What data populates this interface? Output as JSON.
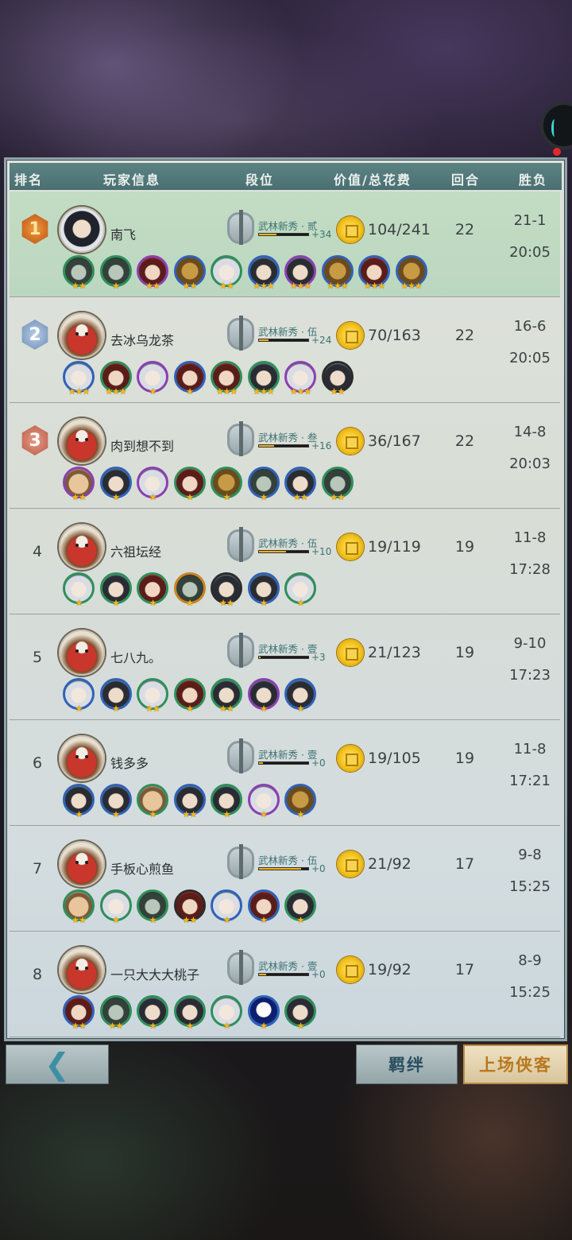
{
  "header": {
    "rank": "排名",
    "player": "玩家信息",
    "tier": "段位",
    "value": "价值/总花费",
    "rounds": "回合",
    "winloss": "胜负"
  },
  "players": [
    {
      "rank": "1",
      "name": "南飞",
      "tier": "武林新秀 · 贰",
      "tier_plus": "+34",
      "tier_progress": 0.35,
      "value": "104/241",
      "rounds": "22",
      "winloss": "21-1",
      "time": "20:05"
    },
    {
      "rank": "2",
      "name": "去冰乌龙茶",
      "tier": "武林新秀 · 伍",
      "tier_plus": "+24",
      "tier_progress": 0.2,
      "value": "70/163",
      "rounds": "22",
      "winloss": "16-6",
      "time": "20:05"
    },
    {
      "rank": "3",
      "name": "肉到想不到",
      "tier": "武林新秀 · 叁",
      "tier_plus": "+16",
      "tier_progress": 0.3,
      "value": "36/167",
      "rounds": "22",
      "winloss": "14-8",
      "time": "20:03"
    },
    {
      "rank": "4",
      "name": "六祖坛经",
      "tier": "武林新秀 · 伍",
      "tier_plus": "+10",
      "tier_progress": 0.55,
      "value": "19/119",
      "rounds": "19",
      "winloss": "11-8",
      "time": "17:28"
    },
    {
      "rank": "5",
      "name": "七八九。",
      "tier": "武林新秀 · 壹",
      "tier_plus": "+3",
      "tier_progress": 0.03,
      "value": "21/123",
      "rounds": "19",
      "winloss": "9-10",
      "time": "17:23"
    },
    {
      "rank": "6",
      "name": "钱多多",
      "tier": "武林新秀 · 壹",
      "tier_plus": "+0",
      "tier_progress": 0.08,
      "value": "19/105",
      "rounds": "19",
      "winloss": "11-8",
      "time": "17:21"
    },
    {
      "rank": "7",
      "name": "手板心煎鱼",
      "tier": "武林新秀 · 伍",
      "tier_plus": "+0",
      "tier_progress": 0.85,
      "value": "21/92",
      "rounds": "17",
      "winloss": "9-8",
      "time": "15:25"
    },
    {
      "rank": "8",
      "name": "一只大大大桃子",
      "tier": "武林新秀 · 壹",
      "tier_plus": "+0",
      "tier_progress": 0.15,
      "value": "19/92",
      "rounds": "17",
      "winloss": "8-9",
      "time": "15:25"
    }
  ],
  "heroes": [
    [
      {
        "s": "★★",
        "c": "green",
        "t": "mask"
      },
      {
        "s": "★",
        "c": "green",
        "t": "mask"
      },
      {
        "s": "★★",
        "c": "purple",
        "t": "red"
      },
      {
        "s": "★★",
        "c": "blue",
        "t": "beast"
      },
      {
        "s": "★★",
        "c": "green",
        "t": "white"
      },
      {
        "s": "★★★",
        "c": "blue",
        "t": ""
      },
      {
        "s": "★★★",
        "c": "purple",
        "t": ""
      },
      {
        "s": "★★★",
        "c": "blue",
        "t": "beast"
      },
      {
        "s": "★★★",
        "c": "blue",
        "t": "red"
      },
      {
        "s": "★★★",
        "c": "blue",
        "t": "beast"
      }
    ],
    [
      {
        "s": "★★★",
        "c": "blue",
        "t": "white"
      },
      {
        "s": "★★★",
        "c": "green",
        "t": "red"
      },
      {
        "s": "★",
        "c": "purple",
        "t": "white"
      },
      {
        "s": "★",
        "c": "blue",
        "t": "red"
      },
      {
        "s": "★★★",
        "c": "green",
        "t": "red"
      },
      {
        "s": "★★★",
        "c": "green",
        "t": ""
      },
      {
        "s": "★★★",
        "c": "purple",
        "t": "white"
      },
      {
        "s": "★★",
        "c": "dark",
        "t": ""
      }
    ],
    [
      {
        "s": "★★",
        "c": "purple",
        "t": "fat"
      },
      {
        "s": "★",
        "c": "blue",
        "t": ""
      },
      {
        "s": "★",
        "c": "purple",
        "t": "white"
      },
      {
        "s": "★",
        "c": "green",
        "t": "red"
      },
      {
        "s": "★",
        "c": "green",
        "t": "beast"
      },
      {
        "s": "★",
        "c": "blue",
        "t": "mask"
      },
      {
        "s": "★★",
        "c": "blue",
        "t": ""
      },
      {
        "s": "★★",
        "c": "green",
        "t": "mask"
      }
    ],
    [
      {
        "s": "★",
        "c": "green",
        "t": "white"
      },
      {
        "s": "★",
        "c": "green",
        "t": ""
      },
      {
        "s": "★",
        "c": "green",
        "t": "red"
      },
      {
        "s": "★",
        "c": "orange",
        "t": "mask"
      },
      {
        "s": "★★",
        "c": "dark",
        "t": ""
      },
      {
        "s": "★",
        "c": "blue",
        "t": ""
      },
      {
        "s": "★",
        "c": "green",
        "t": "white"
      }
    ],
    [
      {
        "s": "★",
        "c": "blue",
        "t": "white"
      },
      {
        "s": "★",
        "c": "blue",
        "t": ""
      },
      {
        "s": "★★",
        "c": "green",
        "t": "white"
      },
      {
        "s": "★",
        "c": "green",
        "t": "red"
      },
      {
        "s": "★★",
        "c": "green",
        "t": ""
      },
      {
        "s": "★",
        "c": "purple",
        "t": ""
      },
      {
        "s": "★",
        "c": "blue",
        "t": ""
      }
    ],
    [
      {
        "s": "★",
        "c": "blue",
        "t": ""
      },
      {
        "s": "★",
        "c": "blue",
        "t": ""
      },
      {
        "s": "★",
        "c": "green",
        "t": "fat"
      },
      {
        "s": "★★",
        "c": "blue",
        "t": ""
      },
      {
        "s": "★",
        "c": "green",
        "t": ""
      },
      {
        "s": "★",
        "c": "purple",
        "t": "white"
      },
      {
        "s": "★",
        "c": "blue",
        "t": "beast"
      }
    ],
    [
      {
        "s": "★★",
        "c": "green",
        "t": "fat"
      },
      {
        "s": "★",
        "c": "green",
        "t": "white"
      },
      {
        "s": "★",
        "c": "green",
        "t": "mask"
      },
      {
        "s": "★★",
        "c": "dark",
        "t": "red"
      },
      {
        "s": "★",
        "c": "blue",
        "t": "white"
      },
      {
        "s": "★",
        "c": "blue",
        "t": "red"
      },
      {
        "s": "★",
        "c": "green",
        "t": ""
      }
    ],
    [
      {
        "s": "★★",
        "c": "blue",
        "t": "red"
      },
      {
        "s": "★★",
        "c": "green",
        "t": "mask"
      },
      {
        "s": "★",
        "c": "green",
        "t": ""
      },
      {
        "s": "★",
        "c": "green",
        "t": ""
      },
      {
        "s": "★",
        "c": "green",
        "t": "white"
      },
      {
        "s": "★",
        "c": "blue",
        "t": "ghost"
      },
      {
        "s": "★",
        "c": "green",
        "t": ""
      }
    ]
  ],
  "buttons": {
    "back_icon": "arrow-left-icon",
    "bond": "羁绊",
    "deploy": "上场侠客"
  }
}
